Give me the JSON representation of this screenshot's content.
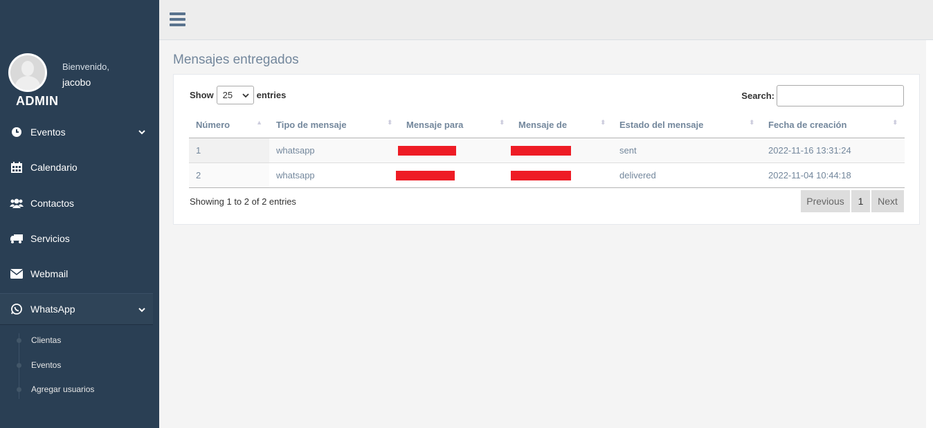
{
  "sidebar": {
    "welcome": "Bienvenido,",
    "username": "jacobo",
    "role": "ADMIN",
    "items": [
      {
        "label": "Eventos",
        "icon": "clock-icon",
        "has_chevron": true
      },
      {
        "label": "Calendario",
        "icon": "calendar-icon",
        "has_chevron": false
      },
      {
        "label": "Contactos",
        "icon": "users-icon",
        "has_chevron": false
      },
      {
        "label": "Servicios",
        "icon": "truck-icon",
        "has_chevron": false
      },
      {
        "label": "Webmail",
        "icon": "envelope-icon",
        "has_chevron": false
      },
      {
        "label": "WhatsApp",
        "icon": "whatsapp-icon",
        "has_chevron": true
      }
    ],
    "submenu": [
      {
        "label": "Clientas"
      },
      {
        "label": "Eventos"
      },
      {
        "label": "Agregar usuarios"
      }
    ]
  },
  "topbar": {
    "menu_icon": "hamburger-icon"
  },
  "page": {
    "title": "Mensajes entregados"
  },
  "table_controls": {
    "show_label": "Show",
    "entries_value": "25",
    "entries_label": "entries",
    "search_label": "Search:",
    "search_value": ""
  },
  "table": {
    "columns": [
      "Número",
      "Tipo de mensaje",
      "Mensaje para",
      "Mensaje de",
      "Estado del mensaje",
      "Fecha de creación"
    ],
    "rows": [
      {
        "numero": "1",
        "tipo": "whatsapp",
        "para": "[redacted]",
        "de": "[redacted]",
        "estado": "sent",
        "fecha": "2022-11-16 13:31:24"
      },
      {
        "numero": "2",
        "tipo": "whatsapp",
        "para": "[redacted]",
        "de": "[redacted]",
        "estado": "delivered",
        "fecha": "2022-11-04 10:44:18"
      }
    ]
  },
  "footer": {
    "info": "Showing 1 to 2 of 2 entries",
    "previous": "Previous",
    "page": "1",
    "next": "Next"
  },
  "colors": {
    "sidebar_bg": "#2a3f54",
    "text_muted": "#73879c",
    "redaction": "#ee1c25"
  }
}
